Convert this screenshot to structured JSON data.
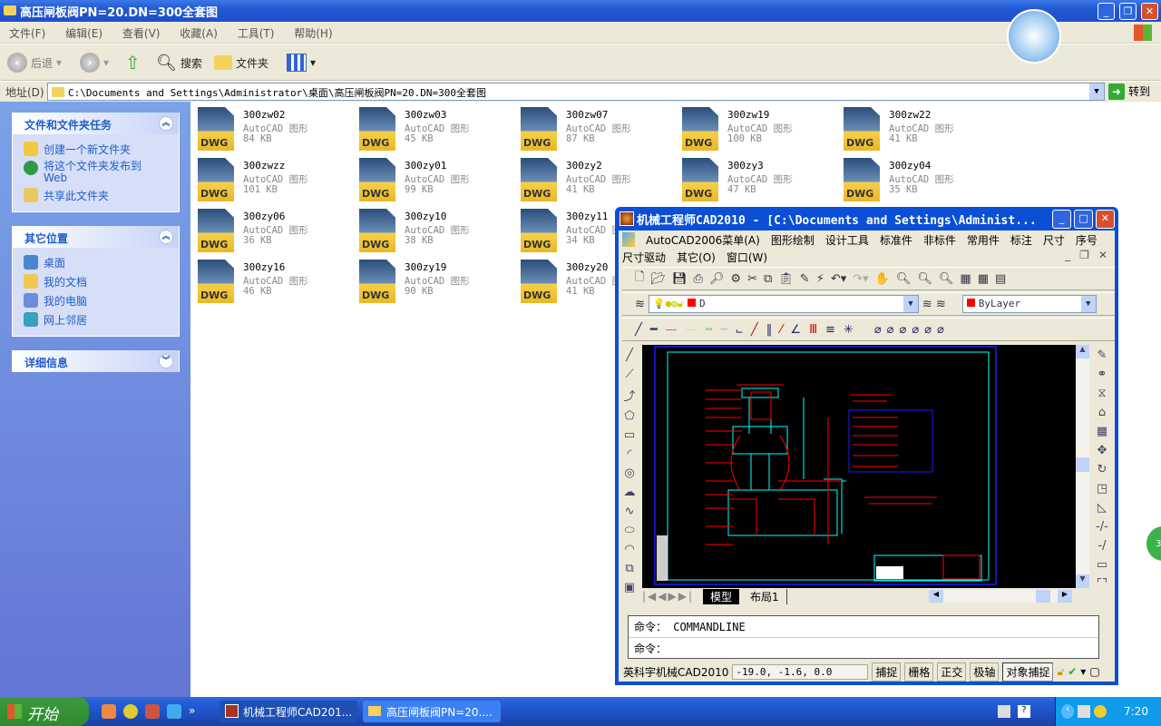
{
  "explorer": {
    "title": "高压闸板阀PN=20.DN=300全套图",
    "menu": [
      "文件(F)",
      "编辑(E)",
      "查看(V)",
      "收藏(A)",
      "工具(T)",
      "帮助(H)"
    ],
    "toolbar": {
      "back": "后退",
      "search": "搜索",
      "folders": "文件夹"
    },
    "address": {
      "label": "地址(D)",
      "value": "C:\\Documents and Settings\\Administrator\\桌面\\高压闸板阀PN=20.DN=300全套图",
      "go": "转到"
    },
    "tasks": {
      "title": "文件和文件夹任务",
      "items": [
        "创建一个新文件夹",
        "将这个文件夹发布到 Web",
        "共享此文件夹"
      ]
    },
    "places": {
      "title": "其它位置",
      "items": [
        "桌面",
        "我的文档",
        "我的电脑",
        "网上邻居"
      ]
    },
    "details": {
      "title": "详细信息"
    },
    "files": [
      {
        "name": "300zw02",
        "type": "AutoCAD 图形",
        "size": "84 KB"
      },
      {
        "name": "300zw03",
        "type": "AutoCAD 图形",
        "size": "45 KB"
      },
      {
        "name": "300zw07",
        "type": "AutoCAD 图形",
        "size": "87 KB"
      },
      {
        "name": "300zw19",
        "type": "AutoCAD 图形",
        "size": "100 KB"
      },
      {
        "name": "300zw22",
        "type": "AutoCAD 图形",
        "size": "41 KB"
      },
      {
        "name": "300zwzz",
        "type": "AutoCAD 图形",
        "size": "101 KB"
      },
      {
        "name": "300zy01",
        "type": "AutoCAD 图形",
        "size": "99 KB"
      },
      {
        "name": "300zy2",
        "type": "AutoCAD 图形",
        "size": "41 KB"
      },
      {
        "name": "300zy3",
        "type": "AutoCAD 图形",
        "size": "47 KB"
      },
      {
        "name": "300zy04",
        "type": "AutoCAD 图形",
        "size": "35 KB"
      },
      {
        "name": "300zy06",
        "type": "AutoCAD 图形",
        "size": "36 KB"
      },
      {
        "name": "300zy10",
        "type": "AutoCAD 图形",
        "size": "38 KB"
      },
      {
        "name": "300zy11",
        "type": "AutoCAD 图形",
        "size": "34 KB"
      },
      null,
      null,
      {
        "name": "300zy16",
        "type": "AutoCAD 图形",
        "size": "46 KB"
      },
      {
        "name": "300zy19",
        "type": "AutoCAD 图形",
        "size": "90 KB"
      },
      {
        "name": "300zy20",
        "type": "AutoCAD 图形",
        "size": "41 KB"
      }
    ],
    "file_icon_label": "DWG"
  },
  "cad": {
    "title": "机械工程师CAD2010 - [C:\\Documents and Settings\\Administ...",
    "menu1": [
      "AutoCAD2006菜单(A)",
      "图形绘制",
      "设计工具",
      "标准件",
      "非标件",
      "常用件",
      "标注",
      "尺寸",
      "序号"
    ],
    "menu2": [
      "尺寸驱动",
      "其它(O)",
      "窗口(W)"
    ],
    "layer": "D",
    "color": "ByLayer",
    "tabs": [
      "模型",
      "布局1"
    ],
    "command_history": "命令： COMMANDLINE",
    "command_prompt": "命令：",
    "status": {
      "app": "英科宇机械CAD2010",
      "coords": "-19.0, -1.6, 0.0",
      "toggles": [
        "捕捉",
        "栅格",
        "正交",
        "极轴",
        "对象捕捉"
      ]
    },
    "colors": {
      "canvas": "#000000",
      "frame": "#00ffff",
      "geometry": "#ff0000",
      "border": "#0000ff"
    }
  },
  "taskbar": {
    "start": "开始",
    "tasks": [
      "机械工程师CAD201...",
      "高压闸板阀PN=20...."
    ],
    "clock": "7:20"
  }
}
